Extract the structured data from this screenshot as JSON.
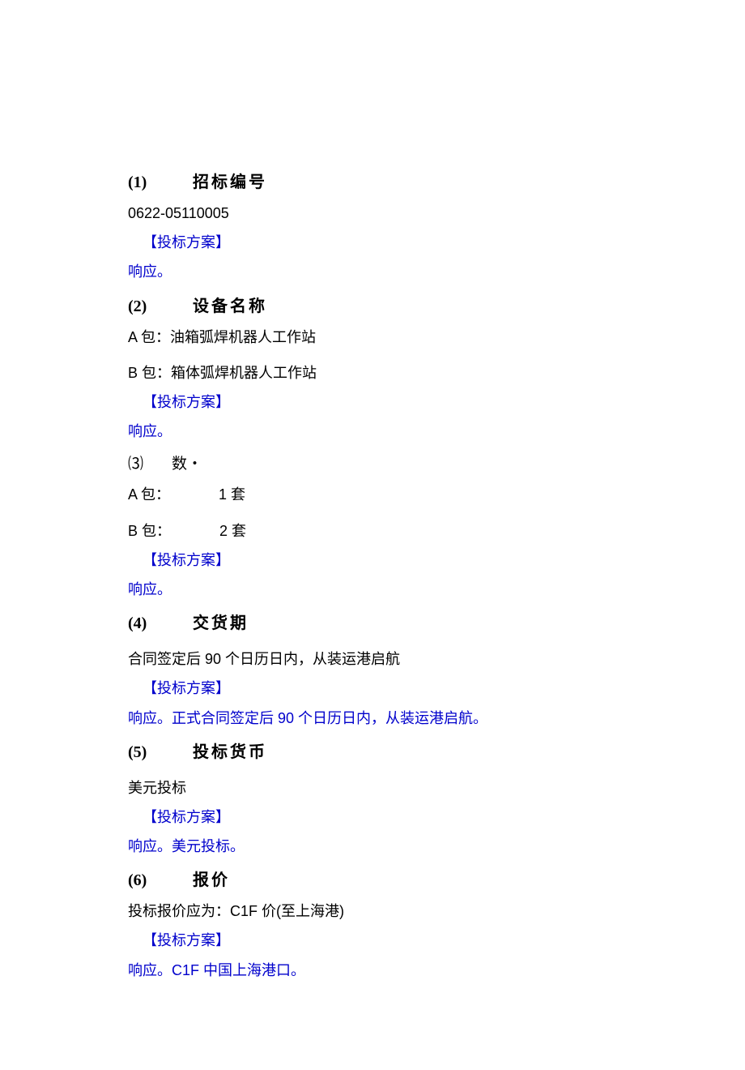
{
  "sections": {
    "s1": {
      "num": "(1)",
      "title": "招标编号",
      "content": "0622-05110005",
      "bid_label": "【投标方案】",
      "bid_response": "响应。"
    },
    "s2": {
      "num": "(2)",
      "title": "设备名称",
      "content_a": "A 包：油箱弧焊机器人工作站",
      "content_b": "B 包：箱体弧焊机器人工作站",
      "bid_label": "【投标方案】",
      "bid_response": "响应。"
    },
    "s3": {
      "num": "⑶",
      "title": "数・",
      "content_a_prefix": "A 包：",
      "content_a_value": "1 套",
      "content_b_prefix": "B 包：",
      "content_b_value": "2 套",
      "bid_label": "【投标方案】",
      "bid_response": "响应。"
    },
    "s4": {
      "num": "(4)",
      "title": "交货期",
      "content": "合同签定后 90 个日历日内，从装运港启航",
      "bid_label": "【投标方案】",
      "bid_response": "响应。正式合同签定后 90 个日历日内，从装运港启航。"
    },
    "s5": {
      "num": "(5)",
      "title": "投标货币",
      "content": "美元投标",
      "bid_label": "【投标方案】",
      "bid_response": "响应。美元投标。"
    },
    "s6": {
      "num": "(6)",
      "title": "报价",
      "content": "投标报价应为：C1F 价(至上海港)",
      "bid_label": "【投标方案】",
      "bid_response": "响应。C1F 中国上海港口。"
    }
  }
}
